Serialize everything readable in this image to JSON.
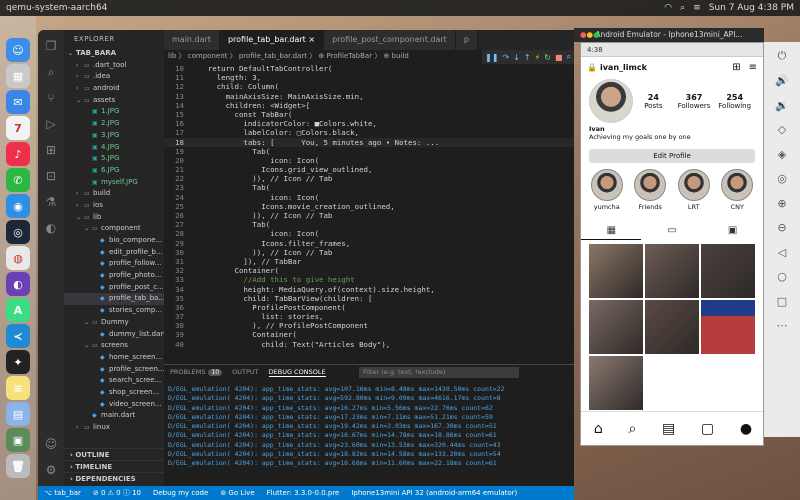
{
  "host_bar": {
    "title": "qemu-system-aarch64",
    "datetime": "Sun 7 Aug 4:38 PM"
  },
  "dock": {
    "apps": [
      {
        "name": "finder",
        "color": "#3b8fe6",
        "glyph": "☺"
      },
      {
        "name": "launchpad",
        "color": "#c9c9c9",
        "glyph": "▦"
      },
      {
        "name": "mail",
        "color": "#3a86e8",
        "glyph": "✉"
      },
      {
        "name": "calendar",
        "color": "#f2f2f2",
        "glyph": "7"
      },
      {
        "name": "music",
        "color": "#f0304a",
        "glyph": "♪"
      },
      {
        "name": "whatsapp",
        "color": "#2bb741",
        "glyph": "✆"
      },
      {
        "name": "safari",
        "color": "#2f8fe4",
        "glyph": "◉"
      },
      {
        "name": "steam",
        "color": "#1b2838",
        "glyph": "◎"
      },
      {
        "name": "chrome",
        "color": "#e8e8e8",
        "glyph": "◍"
      },
      {
        "name": "github",
        "color": "#6c3fb5",
        "glyph": "◐"
      },
      {
        "name": "android-studio",
        "color": "#3ddc84",
        "glyph": "A"
      },
      {
        "name": "vscode",
        "color": "#1f8ad2",
        "glyph": "≺"
      },
      {
        "name": "figma",
        "color": "#222",
        "glyph": "✦"
      },
      {
        "name": "notes",
        "color": "#f6e27a",
        "glyph": "≡"
      },
      {
        "name": "preview",
        "color": "#8ab4e8",
        "glyph": "▤"
      },
      {
        "name": "emulator",
        "color": "#5b8b5b",
        "glyph": "▣"
      },
      {
        "name": "trash",
        "color": "#bbbbbb",
        "glyph": "🗑"
      }
    ]
  },
  "explorer": {
    "header": "EXPLORER",
    "project": "TAB_BARA",
    "tree": [
      {
        "label": ".dart_tool",
        "depth": 1,
        "type": "folder",
        "open": false
      },
      {
        "label": ".idea",
        "depth": 1,
        "type": "folder",
        "open": false
      },
      {
        "label": "android",
        "depth": 1,
        "type": "folder",
        "open": false
      },
      {
        "label": "assets",
        "depth": 1,
        "type": "folder",
        "open": true
      },
      {
        "label": "1.JPG",
        "depth": 2,
        "type": "image"
      },
      {
        "label": "2.JPG",
        "depth": 2,
        "type": "image"
      },
      {
        "label": "3.JPG",
        "depth": 2,
        "type": "image"
      },
      {
        "label": "4.JPG",
        "depth": 2,
        "type": "image"
      },
      {
        "label": "5.JPG",
        "depth": 2,
        "type": "image"
      },
      {
        "label": "6.JPG",
        "depth": 2,
        "type": "image"
      },
      {
        "label": "myself.JPG",
        "depth": 2,
        "type": "image"
      },
      {
        "label": "build",
        "depth": 1,
        "type": "folder",
        "open": false
      },
      {
        "label": "ios",
        "depth": 1,
        "type": "folder",
        "open": false
      },
      {
        "label": "lib",
        "depth": 1,
        "type": "folder",
        "open": true
      },
      {
        "label": "component",
        "depth": 2,
        "type": "folder",
        "open": true
      },
      {
        "label": "bio_compone...",
        "depth": 3,
        "type": "dart"
      },
      {
        "label": "edit_profile_b...",
        "depth": 3,
        "type": "dart"
      },
      {
        "label": "profile_follow...",
        "depth": 3,
        "type": "dart"
      },
      {
        "label": "profile_photo...",
        "depth": 3,
        "type": "dart"
      },
      {
        "label": "profile_post_c...",
        "depth": 3,
        "type": "dart"
      },
      {
        "label": "profile_tab_ba...",
        "depth": 3,
        "type": "dart",
        "selected": true
      },
      {
        "label": "stories_comp...",
        "depth": 3,
        "type": "dart"
      },
      {
        "label": "Dummy",
        "depth": 2,
        "type": "folder",
        "open": true
      },
      {
        "label": "dummy_list.dart",
        "depth": 3,
        "type": "dart"
      },
      {
        "label": "screens",
        "depth": 2,
        "type": "folder",
        "open": true
      },
      {
        "label": "home_screen...",
        "depth": 3,
        "type": "dart"
      },
      {
        "label": "profile_screen...",
        "depth": 3,
        "type": "dart"
      },
      {
        "label": "search_scree...",
        "depth": 3,
        "type": "dart"
      },
      {
        "label": "shop_screen...",
        "depth": 3,
        "type": "dart"
      },
      {
        "label": "video_screen...",
        "depth": 3,
        "type": "dart"
      },
      {
        "label": "main.dart",
        "depth": 2,
        "type": "dart"
      },
      {
        "label": "linux",
        "depth": 1,
        "type": "folder",
        "open": false
      }
    ],
    "sections": [
      "OUTLINE",
      "TIMELINE",
      "DEPENDENCIES"
    ]
  },
  "tabs": [
    {
      "label": "main.dart",
      "active": false
    },
    {
      "label": "profile_tab_bar.dart ×",
      "active": true
    },
    {
      "label": "profile_post_component.dart",
      "active": false
    },
    {
      "label": "p",
      "active": false
    }
  ],
  "breadcrumb": "lib 〉 component 〉 profile_tab_bar.dart 〉 ⊕ ProfileTabBar 〉 ⊕ build",
  "code_lines": [
    {
      "n": "10",
      "t": "    return DefaultTabController("
    },
    {
      "n": "11",
      "t": "      length: 3,"
    },
    {
      "n": "12",
      "t": "      child: Column("
    },
    {
      "n": "13",
      "t": "        mainAxisSize: MainAxisSize.min,"
    },
    {
      "n": "14",
      "t": "        children: <Widget>["
    },
    {
      "n": "15",
      "t": "          const TabBar("
    },
    {
      "n": "16",
      "t": "            indicatorColor: ■Colors.white,"
    },
    {
      "n": "17",
      "t": "            labelColor: □Colors.black,"
    },
    {
      "n": "18",
      "t": "            tabs: [      You, 5 minutes ago • Notes: ..."
    },
    {
      "n": "19",
      "t": "              Tab("
    },
    {
      "n": "20",
      "t": "                  icon: Icon("
    },
    {
      "n": "21",
      "t": "                Icons.grid_view_outlined,"
    },
    {
      "n": "22",
      "t": "              )), // Icon // Tab"
    },
    {
      "n": "23",
      "t": "              Tab("
    },
    {
      "n": "24",
      "t": "                  icon: Icon("
    },
    {
      "n": "25",
      "t": "                Icons.movie_creation_outlined,"
    },
    {
      "n": "26",
      "t": "              )), // Icon // Tab"
    },
    {
      "n": "27",
      "t": "              Tab("
    },
    {
      "n": "28",
      "t": "                  icon: Icon("
    },
    {
      "n": "29",
      "t": "                Icons.filter_frames,"
    },
    {
      "n": "30",
      "t": "              )), // Icon // Tab"
    },
    {
      "n": "31",
      "t": "            ]), // TabBar"
    },
    {
      "n": "32",
      "t": "          Container("
    },
    {
      "n": "33",
      "t": "            //Add this to give height"
    },
    {
      "n": "34",
      "t": "            height: MediaQuery.of(context).size.height,"
    },
    {
      "n": "35",
      "t": "            child: TabBarView(children: ["
    },
    {
      "n": "36",
      "t": "              ProfilePostComponent("
    },
    {
      "n": "37",
      "t": "                list: stories,"
    },
    {
      "n": "38",
      "t": "              ), // ProfilePostComponent"
    },
    {
      "n": "39",
      "t": "              Container("
    },
    {
      "n": "40",
      "t": "                child: Text(\"Articles Body\"),"
    }
  ],
  "current_line": "18",
  "panel": {
    "tabs": [
      {
        "label": "PROBLEMS",
        "badge": "10"
      },
      {
        "label": "OUTPUT"
      },
      {
        "label": "DEBUG CONSOLE",
        "active": true
      }
    ],
    "filter_placeholder": "Filter (e.g. text, !exclude)",
    "log": [
      "D/EGL_emulation( 4204): app_time_stats: avg=107.16ms min=8.48ms max=1430.50ms count=22",
      "D/EGL_emulation( 4204): app_time_stats: avg=592.80ms min=9.09ms max=4616.17ms count=8",
      "D/EGL_emulation( 4204): app_time_stats: avg=16.27ms min=5.56ms max=22.76ms count=62",
      "D/EGL_emulation( 4204): app_time_stats: avg=17.23ms min=7.11ms max=51.21ms count=59",
      "D/EGL_emulation( 4204): app_time_stats: avg=19.42ms min=3.03ms max=167.30ms count=51",
      "D/EGL_emulation( 4204): app_time_stats: avg=16.67ms min=14.78ms max=18.86ms count=61",
      "D/EGL_emulation( 4204): app_time_stats: avg=23.60ms min=13.53ms max=320.44ms count=43",
      "D/EGL_emulation( 4204): app_time_stats: avg=18.82ms min=14.58ms max=133.20ms count=54",
      "D/EGL_emulation( 4204): app_time_stats: avg=16.68ms min=11.60ms max=22.18ms count=61"
    ]
  },
  "status": [
    "⌥ tab_bar",
    "⊘ 0 ⚠ 0 ⓘ 10",
    "Debug my code",
    "⊚ Go Live",
    "Flutter: 3.3.0-0.0.pre",
    "Iphone13mini API 32 (android-arm64 emulator)"
  ],
  "emulator": {
    "title": "Android Emulator - Iphone13mini_API...",
    "phone_time": "4:38",
    "username": "ivan_limck",
    "stats": [
      {
        "num": "24",
        "label": "Posts"
      },
      {
        "num": "367",
        "label": "Followers"
      },
      {
        "num": "254",
        "label": "Following"
      }
    ],
    "bio_name": "Ivan",
    "bio_text": "Achieving my goals one by one",
    "edit_label": "Edit Profile",
    "stories": [
      "yumcha",
      "Friends",
      "LRT",
      "CNY"
    ],
    "grid_tabs": [
      "▦",
      "▭",
      "▣"
    ],
    "nav": [
      "⌂",
      "⌕",
      "▤",
      "▢",
      "●"
    ],
    "side_icons": [
      "⏻",
      "🔊",
      "🔉",
      "◇",
      "◈",
      "◎",
      "⊕",
      "⊖",
      "◁",
      "○",
      "□",
      "⋯"
    ]
  }
}
